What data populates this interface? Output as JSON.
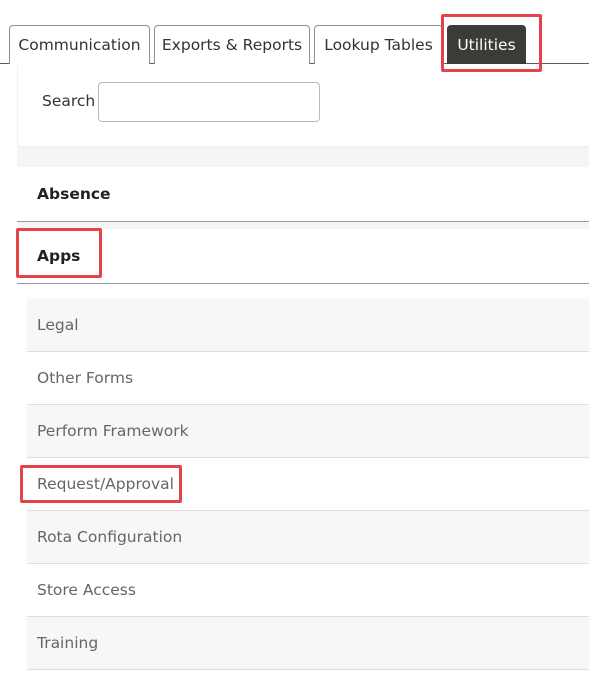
{
  "tabs": [
    {
      "label": "Communication",
      "active": false
    },
    {
      "label": "Exports & Reports",
      "active": false
    },
    {
      "label": "Lookup Tables",
      "active": false
    },
    {
      "label": "Utilities",
      "active": true
    }
  ],
  "search": {
    "label": "Search",
    "value": "",
    "placeholder": ""
  },
  "categories": [
    {
      "label": "Absence"
    },
    {
      "label": "Apps"
    }
  ],
  "items": [
    {
      "label": "Legal"
    },
    {
      "label": "Other Forms"
    },
    {
      "label": "Perform Framework"
    },
    {
      "label": "Request/Approval"
    },
    {
      "label": "Rota Configuration"
    },
    {
      "label": "Store Access"
    },
    {
      "label": "Training"
    }
  ],
  "colors": {
    "active_tab_bg": "#3d3b38",
    "highlight": "#e2444a",
    "item_text": "#666666"
  }
}
